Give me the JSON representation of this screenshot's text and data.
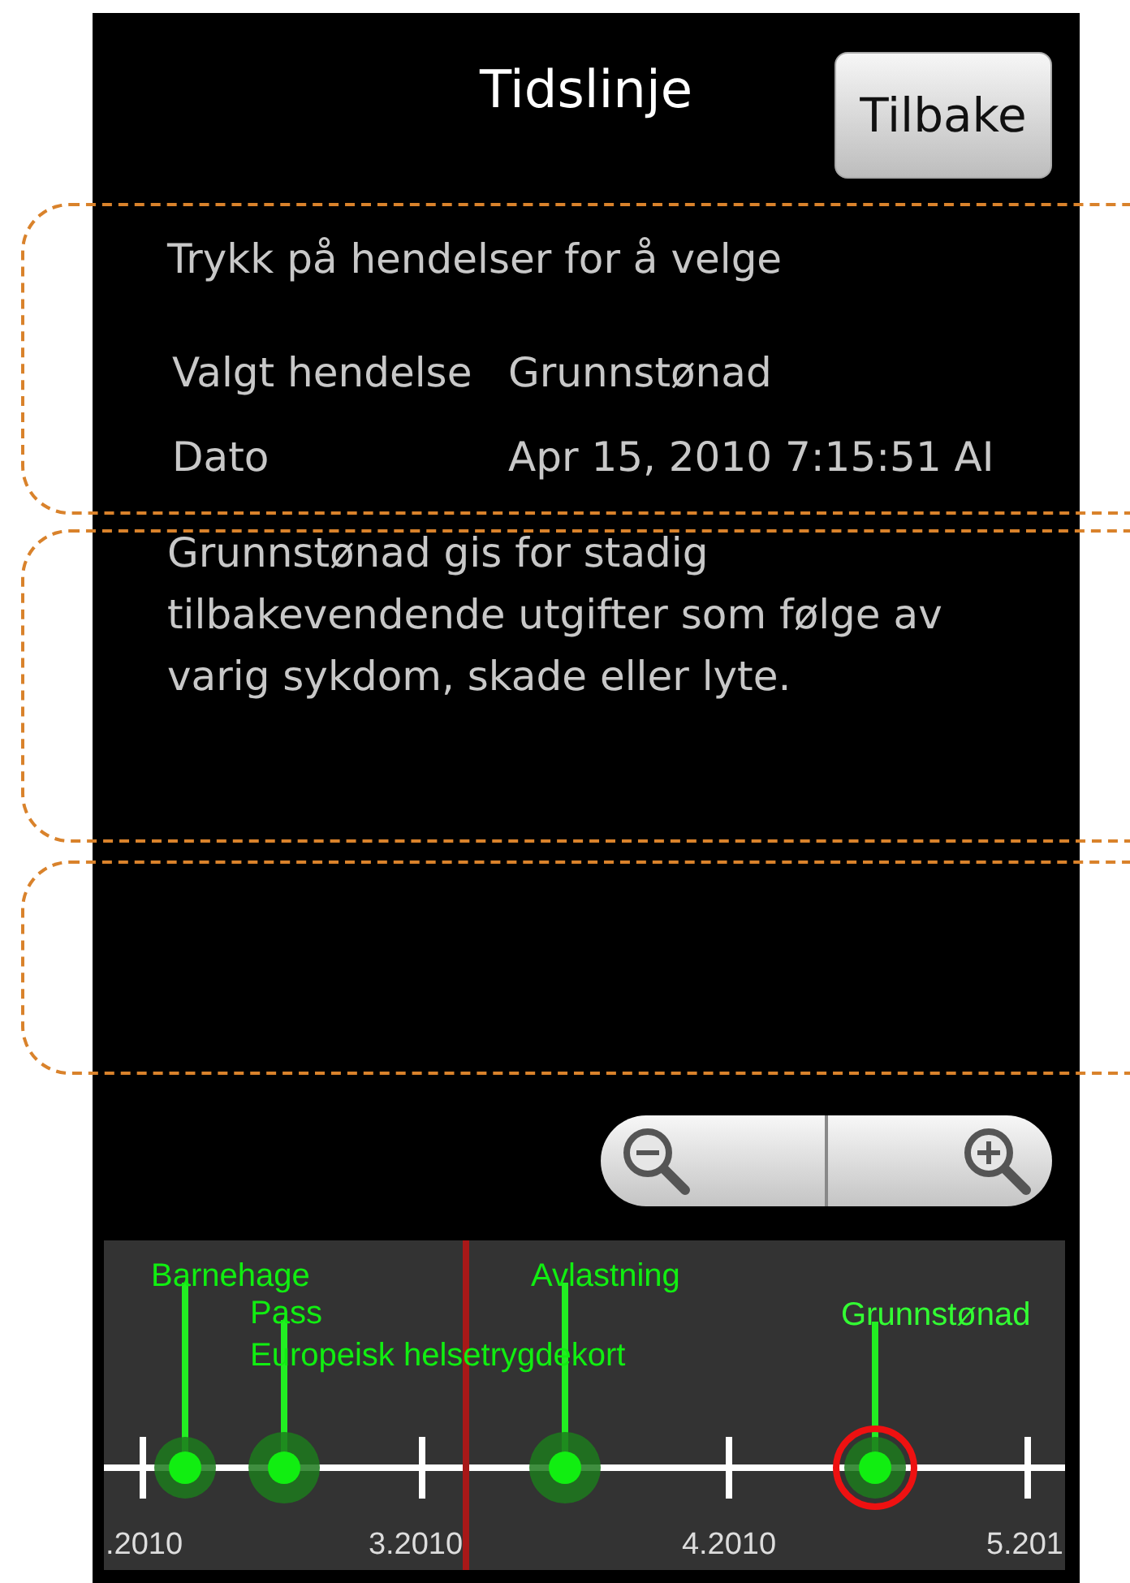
{
  "header": {
    "title": "Tidslinje",
    "back_button": "Tilbake"
  },
  "instruction": "Trykk på hendelser for å velge",
  "details": [
    {
      "label": "Valgt hendelse",
      "value": "Grunnstønad"
    },
    {
      "label": "Dato",
      "value": "Apr 15, 2010 7:15:51 AI"
    }
  ],
  "description": "Grunnstønad gis for stadig tilbakevendende utgifter som følge av varig sykdom, skade eller lyte.",
  "timeline": {
    "axis_labels": [
      ".2010",
      "3.2010",
      "4.2010",
      "5.201"
    ],
    "events": [
      {
        "label": "Barnehage",
        "selected": false
      },
      {
        "label": "Avlastning",
        "selected": false
      },
      {
        "label": "Pass",
        "selected": false
      },
      {
        "label": "Grunnstønad",
        "selected": true
      },
      {
        "label": "Europeisk helsetrygdekort",
        "selected": false
      }
    ]
  }
}
